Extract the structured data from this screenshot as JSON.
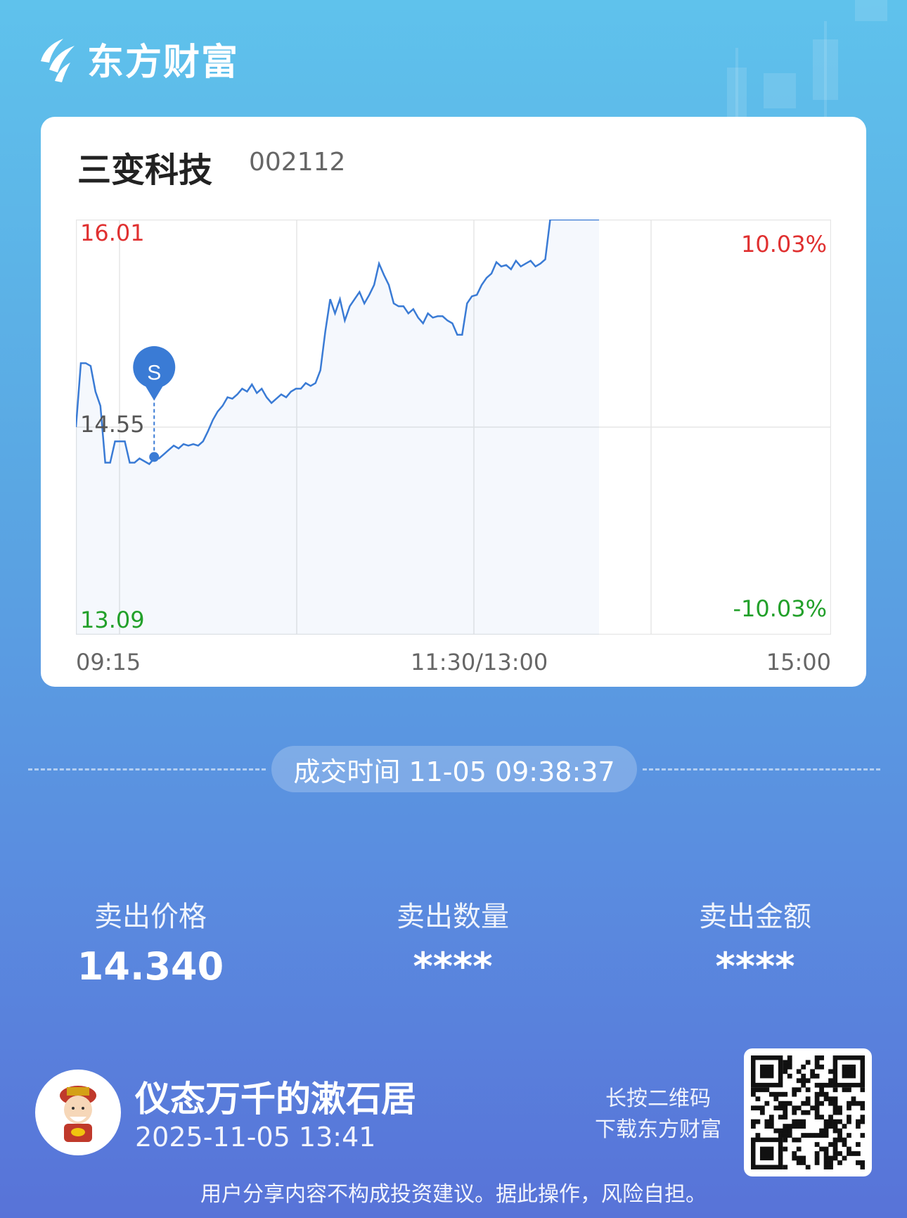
{
  "brand": {
    "name": "东方财富"
  },
  "stock": {
    "name": "三变科技",
    "code": "002112"
  },
  "chart_data": {
    "type": "line",
    "series_name": "",
    "y_high_label": "16.01",
    "y_mid_label": "14.55",
    "y_low_label": "13.09",
    "pct_high_label": "10.03%",
    "pct_low_label": "-10.03%",
    "ylim": [
      13.09,
      16.01
    ],
    "x_tick_labels": [
      "09:15",
      "11:30/13:00",
      "15:00"
    ],
    "price_line_color": "#3a7bd5",
    "up_color": "#e03030",
    "down_color": "#22a02a",
    "prices": [
      14.55,
      15.0,
      15.0,
      14.98,
      14.8,
      14.7,
      14.3,
      14.3,
      14.45,
      14.45,
      14.45,
      14.3,
      14.3,
      14.33,
      14.31,
      14.29,
      14.33,
      14.33,
      14.36,
      14.39,
      14.42,
      14.4,
      14.43,
      14.42,
      14.43,
      14.42,
      14.45,
      14.52,
      14.6,
      14.66,
      14.7,
      14.76,
      14.75,
      14.78,
      14.82,
      14.8,
      14.85,
      14.79,
      14.82,
      14.76,
      14.72,
      14.75,
      14.78,
      14.76,
      14.8,
      14.82,
      14.82,
      14.86,
      14.84,
      14.86,
      14.95,
      15.22,
      15.45,
      15.35,
      15.45,
      15.3,
      15.4,
      15.45,
      15.5,
      15.42,
      15.48,
      15.55,
      15.7,
      15.62,
      15.55,
      15.42,
      15.4,
      15.4,
      15.35,
      15.38,
      15.32,
      15.28,
      15.35,
      15.32,
      15.33,
      15.33,
      15.3,
      15.28,
      15.2,
      15.2,
      15.42,
      15.47,
      15.48,
      15.55,
      15.6,
      15.63,
      15.71,
      15.68,
      15.69,
      15.66,
      15.72,
      15.68,
      15.7,
      15.72,
      15.68,
      15.7,
      15.73,
      16.01,
      16.01,
      16.01,
      16.01,
      16.01,
      16.01,
      16.01,
      16.01,
      16.01,
      16.01,
      16.01
    ],
    "trade_marker": {
      "label": "S",
      "price": 14.34,
      "index": 16
    }
  },
  "trade": {
    "time_text": "成交时间 11-05 09:38:37"
  },
  "stats": {
    "price_label": "卖出价格",
    "price_value": "14.340",
    "qty_label": "卖出数量",
    "qty_value": "****",
    "amount_label": "卖出金额",
    "amount_value": "****"
  },
  "user": {
    "name": "仪态万千的漱石居",
    "datetime": "2025-11-05 13:41"
  },
  "qr": {
    "hint_line1": "长按二维码",
    "hint_line2": "下载东方财富"
  },
  "disclaimer": "用户分享内容不构成投资建议。据此操作，风险自担。"
}
